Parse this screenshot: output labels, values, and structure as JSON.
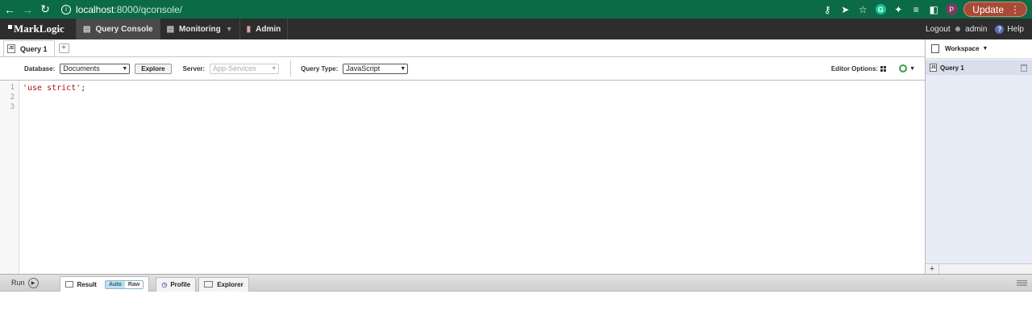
{
  "browser": {
    "url_host": "localhost",
    "url_path": ":8000/qconsole/",
    "profile_initial": "P",
    "grammarly_initial": "G",
    "update_label": "Update"
  },
  "appbar": {
    "logo": "MarkLogic",
    "tabs": [
      {
        "label": "Query Console",
        "icon": "monitor-icon"
      },
      {
        "label": "Monitoring",
        "icon": "chart-icon"
      },
      {
        "label": "Admin",
        "icon": "admin-icon"
      }
    ],
    "logout": "Logout",
    "user": "admin",
    "help": "Help"
  },
  "query_tabs": {
    "tabs": [
      {
        "label": "Query 1"
      }
    ],
    "add_label": "+"
  },
  "options": {
    "database_label": "Database:",
    "database_value": "Documents",
    "explore_label": "Explore",
    "server_label": "Server:",
    "server_value": "App-Services",
    "query_type_label": "Query Type:",
    "query_type_value": "JavaScript",
    "editor_options_label": "Editor Options:"
  },
  "editor": {
    "line_numbers": [
      "1",
      "2",
      "3"
    ],
    "code_string": "'use strict'",
    "code_semicolon": ";"
  },
  "workspace": {
    "title": "Workspace",
    "items": [
      {
        "label": "Query 1"
      }
    ],
    "add_label": "+"
  },
  "results": {
    "run_label": "Run",
    "tabs": [
      "Result",
      "Profile",
      "Explorer"
    ],
    "auto_label": "Auto",
    "raw_label": "Raw"
  }
}
